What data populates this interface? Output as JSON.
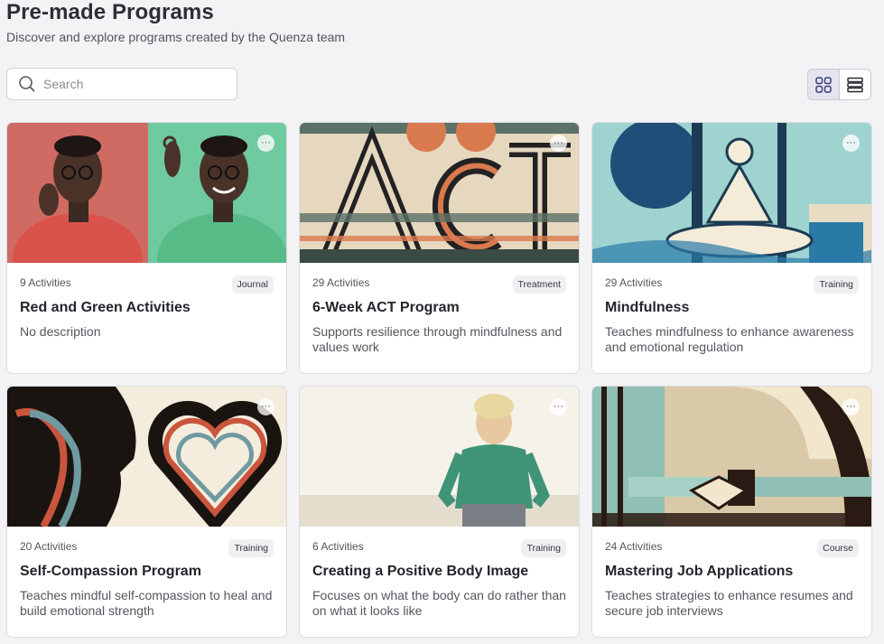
{
  "header": {
    "title": "Pre-made Programs",
    "subtitle": "Discover and explore programs created by the Quenza team"
  },
  "search": {
    "placeholder": "Search",
    "value": ""
  },
  "view_toggle": {
    "active": "grid",
    "grid_icon": "grid-icon",
    "list_icon": "list-icon"
  },
  "programs": [
    {
      "activities": "9 Activities",
      "badge": "Journal",
      "title": "Red and Green Activities",
      "description": "No description"
    },
    {
      "activities": "29 Activities",
      "badge": "Treatment",
      "title": "6-Week ACT Program",
      "description": "Supports resilience through mindfulness and values work"
    },
    {
      "activities": "29 Activities",
      "badge": "Training",
      "title": "Mindfulness",
      "description": "Teaches mindfulness to enhance awareness and emotional regulation"
    },
    {
      "activities": "20 Activities",
      "badge": "Training",
      "title": "Self-Compassion Program",
      "description": "Teaches mindful self-compassion to heal and build emotional strength"
    },
    {
      "activities": "6 Activities",
      "badge": "Training",
      "title": "Creating a Positive Body Image",
      "description": "Focuses on what the body can do rather than on what it looks like"
    },
    {
      "activities": "24 Activities",
      "badge": "Course",
      "title": "Mastering Job Applications",
      "description": "Teaches strategies to enhance resumes and secure job interviews"
    }
  ],
  "card_menu_glyph": "···"
}
